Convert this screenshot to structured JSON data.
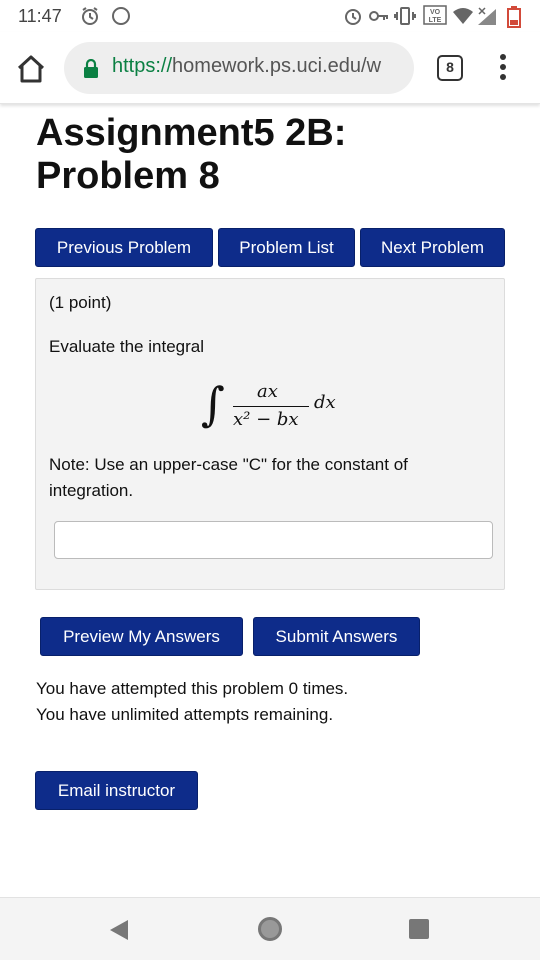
{
  "status_bar": {
    "time": "11:47",
    "icons": [
      "alarm-icon",
      "moon-icon",
      "alarm-clock-icon",
      "key-icon",
      "vibrate-icon",
      "volte-icon",
      "wifi-icon",
      "signal-icon",
      "battery-low-icon"
    ],
    "volte_label": "VO\nLTE",
    "battery_color": "#d24a3a"
  },
  "browser": {
    "url_scheme": "https://",
    "url_rest": "homework.ps.uci.edu/w",
    "tab_count": "8"
  },
  "page": {
    "title": "Assignment5 2B: Problem 8",
    "nav": {
      "previous": "Previous Problem",
      "list": "Problem List",
      "next": "Next Problem"
    },
    "problem": {
      "points": "(1 point)",
      "prompt": "Evaluate the integral",
      "integral": {
        "numerator": "ax",
        "denominator": "x² − bx",
        "differential": "dx"
      },
      "note": "Note: Use an upper-case \"C\" for the constant of integration.",
      "answer_value": ""
    },
    "actions": {
      "preview": "Preview My Answers",
      "submit": "Submit Answers"
    },
    "attempts_line1": "You have attempted this problem 0 times.",
    "attempts_line2": "You have unlimited attempts remaining.",
    "email": "Email instructor"
  },
  "colors": {
    "button_bg": "#0e2c8a",
    "secure_green": "#0b8043",
    "panel_bg": "#f3f3f3"
  }
}
